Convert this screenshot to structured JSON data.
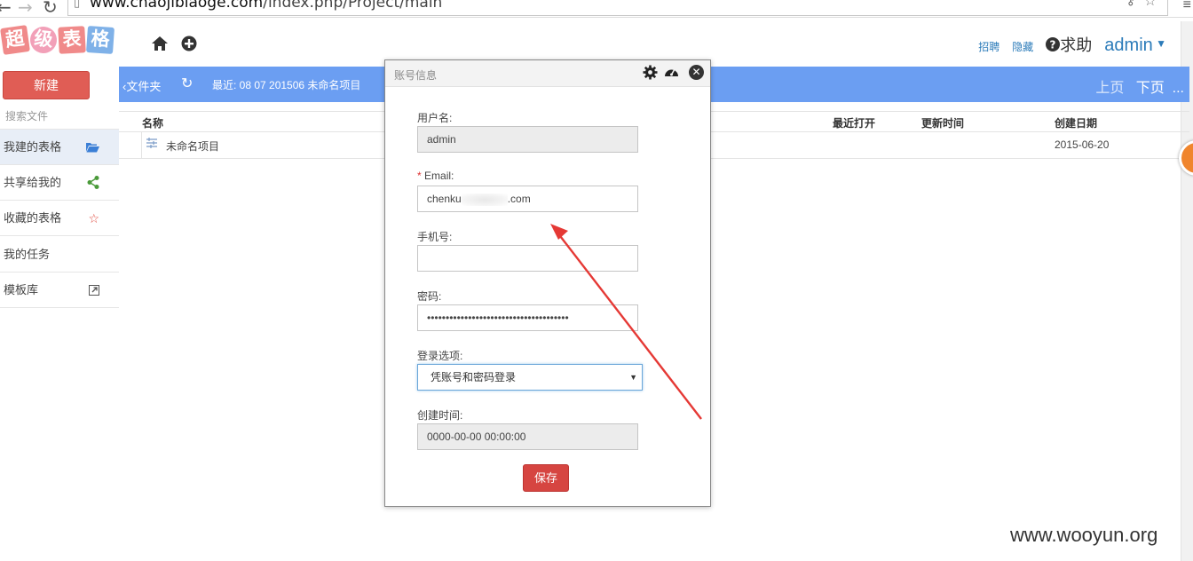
{
  "browser": {
    "url_domain": "www.chaojibiaoge.com",
    "url_path": "/index.php/Project/main"
  },
  "header": {
    "logo_chars": [
      "超",
      "级",
      "表",
      "格"
    ],
    "links": [
      "招聘",
      "隐藏"
    ],
    "help_label": "求助",
    "user_label": "admin"
  },
  "sidebar": {
    "new_button": "新建",
    "search_placeholder": "搜索文件",
    "items": [
      {
        "label": "我建的表格",
        "icon": "folder-open-icon"
      },
      {
        "label": "共享给我的",
        "icon": "share-icon"
      },
      {
        "label": "收藏的表格",
        "icon": "star-icon"
      },
      {
        "label": "我的任务",
        "icon": ""
      },
      {
        "label": "模板库",
        "icon": "external-link-icon"
      }
    ]
  },
  "toolbar": {
    "folder_label": "文件夹",
    "recent_label": "最近: 08   07   201506   未命名项目",
    "prev_page": "上页",
    "next_page": "下页",
    "more": "..."
  },
  "table": {
    "columns": [
      "名称",
      "最近打开",
      "更新时间",
      "创建日期"
    ],
    "rows": [
      {
        "name": "未命名项目",
        "last_opened": "",
        "updated": "",
        "created": "2015-06-20"
      }
    ]
  },
  "modal": {
    "title": "账号信息",
    "fields": {
      "username_label": "用户名:",
      "username_value": "admin",
      "email_required_mark": "*",
      "email_label": "Email:",
      "email_prefix": "chenku",
      "email_suffix": ".com",
      "phone_label": "手机号:",
      "phone_value": "",
      "password_label": "密码:",
      "password_value": "••••••••••••••••••••••••••••••••••••••",
      "login_option_label": "登录选项:",
      "login_option_value": "凭账号和密码登录",
      "created_label": "创建时间:",
      "created_value": "0000-00-00 00:00:00"
    },
    "save_button": "保存"
  },
  "watermark": "www.wooyun.org",
  "colors": {
    "toolbar_bg": "#6b9ef2",
    "new_button_bg": "#e05d55",
    "save_button_bg": "#d64541",
    "link": "#2b7bb9",
    "annotation_arrow": "#e53935"
  }
}
